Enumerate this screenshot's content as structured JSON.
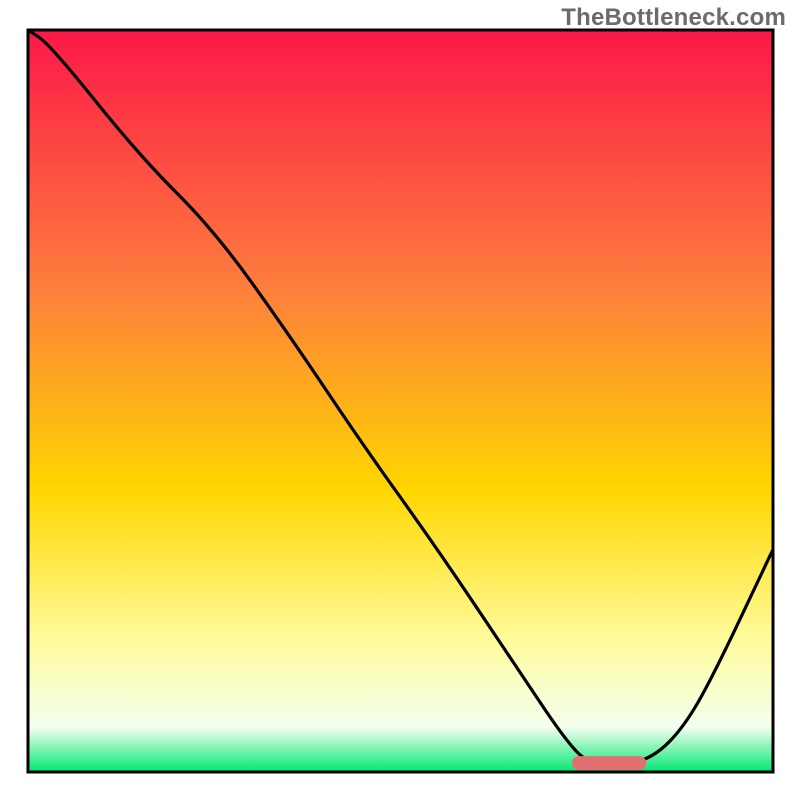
{
  "watermark": "TheBottleneck.com",
  "colors": {
    "gradient_top": "#fc1848",
    "gradient_mid1": "#fd7f3c",
    "gradient_mid2": "#ffd700",
    "gradient_mid3": "#fffb9a",
    "gradient_bottom_pale": "#f4ffef",
    "gradient_bottom": "#00e873",
    "curve": "#000000",
    "frame": "#000000",
    "marker": "#e27070"
  },
  "chart_data": {
    "type": "line",
    "title": "",
    "xlabel": "",
    "ylabel": "",
    "xlim": [
      0,
      100
    ],
    "ylim": [
      0,
      100
    ],
    "series": [
      {
        "name": "bottleneck-curve",
        "x": [
          0,
          3,
          15,
          25,
          35,
          45,
          55,
          65,
          73,
          76,
          80,
          84,
          88,
          92,
          100
        ],
        "values": [
          100,
          98,
          83,
          73,
          59,
          44,
          30,
          15,
          3,
          1,
          1,
          2,
          6,
          13,
          30
        ]
      }
    ],
    "annotations": [
      {
        "name": "optimal-marker",
        "shape": "rounded-bar",
        "x_start": 73,
        "x_end": 83,
        "y": 1.2,
        "color": "#e27070"
      }
    ]
  }
}
